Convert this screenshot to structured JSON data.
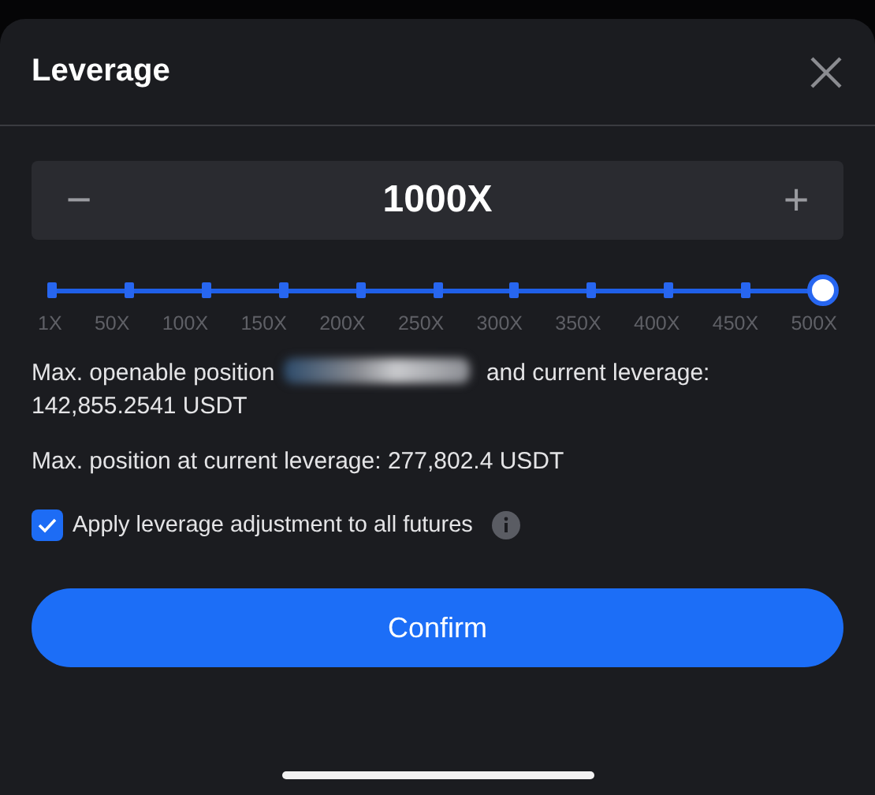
{
  "sheet": {
    "title": "Leverage"
  },
  "stepper": {
    "value": "1000X",
    "minus": "−",
    "plus": "+"
  },
  "slider": {
    "level": 1,
    "ticks": [
      "1X",
      "50X",
      "100X",
      "150X",
      "200X",
      "250X",
      "300X",
      "350X",
      "400X",
      "450X",
      "500X"
    ]
  },
  "info": [
    {
      "before": "Max. openable position",
      "redacted": true,
      "after": "and current leverage: 142,855.2541 USDT"
    },
    {
      "before": "Max. position at current leverage: 277,802.4 USDT",
      "redacted": false
    }
  ],
  "apply_all": {
    "label": "Apply leverage adjustment to all futures",
    "checked": true
  },
  "confirm": "Confirm"
}
